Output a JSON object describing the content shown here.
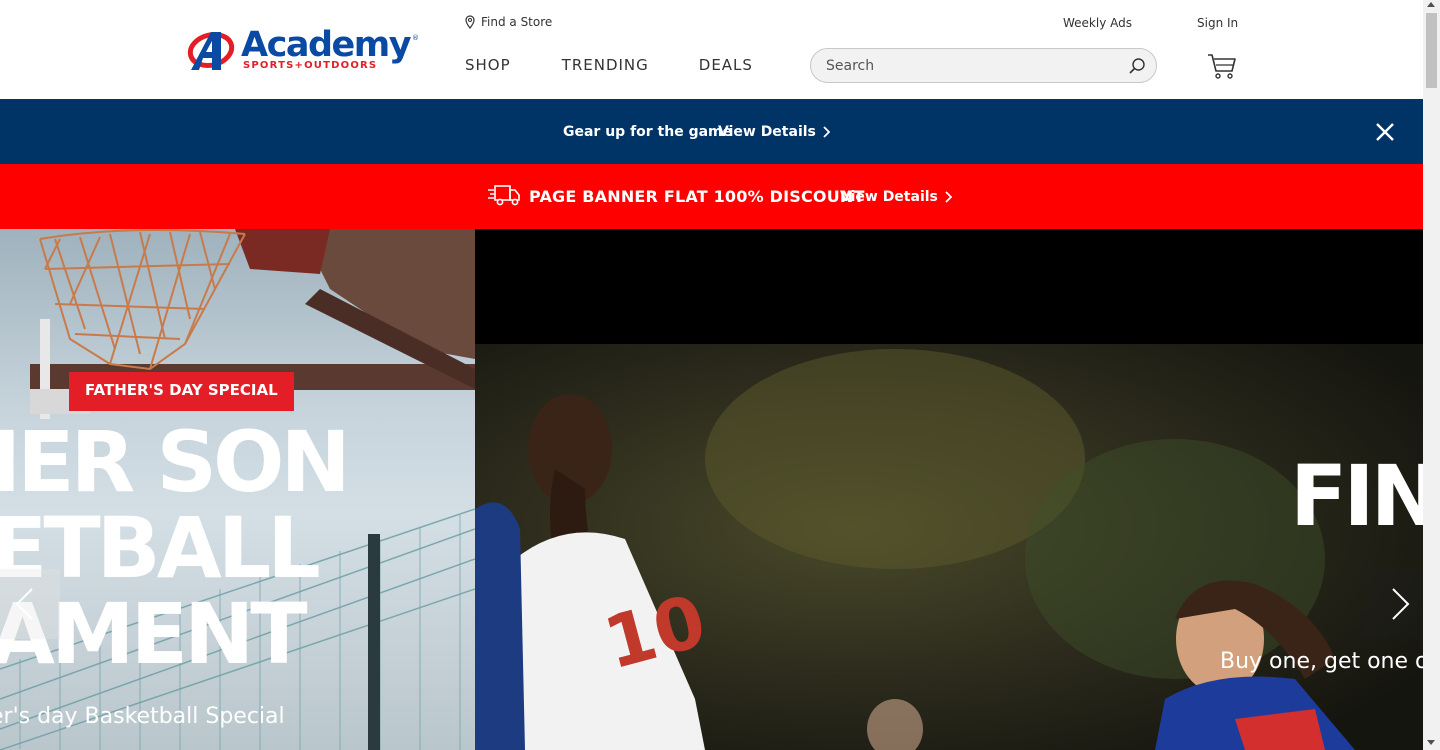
{
  "header": {
    "logo": {
      "word": "Academy",
      "sub": "SPORTS+OUTDOORS",
      "reg": "®"
    },
    "find_store": "Find a Store",
    "weekly_ads": "Weekly Ads",
    "sign_in": "Sign In",
    "nav": [
      "SHOP",
      "TRENDING",
      "DEALS"
    ],
    "search_placeholder": "Search"
  },
  "promo_blue": {
    "text": "Gear up for the game",
    "link": "View Details"
  },
  "promo_red": {
    "text": "PAGE BANNER FLAT 100% DISCOUNT",
    "link": "View Details"
  },
  "hero": {
    "left": {
      "badge": "FATHER'S DAY SPECIAL",
      "title_lines": [
        "IER SON",
        "ETBALL",
        "AMENT"
      ],
      "subtitle": "er's day Basketball Special"
    },
    "right": {
      "title": "FIN",
      "subtitle": "Buy one, get one o"
    }
  },
  "colors": {
    "brand_blue": "#0a4aa3",
    "brand_red": "#e41e26",
    "promo_navy": "#003366",
    "promo_red": "#ff0000"
  }
}
